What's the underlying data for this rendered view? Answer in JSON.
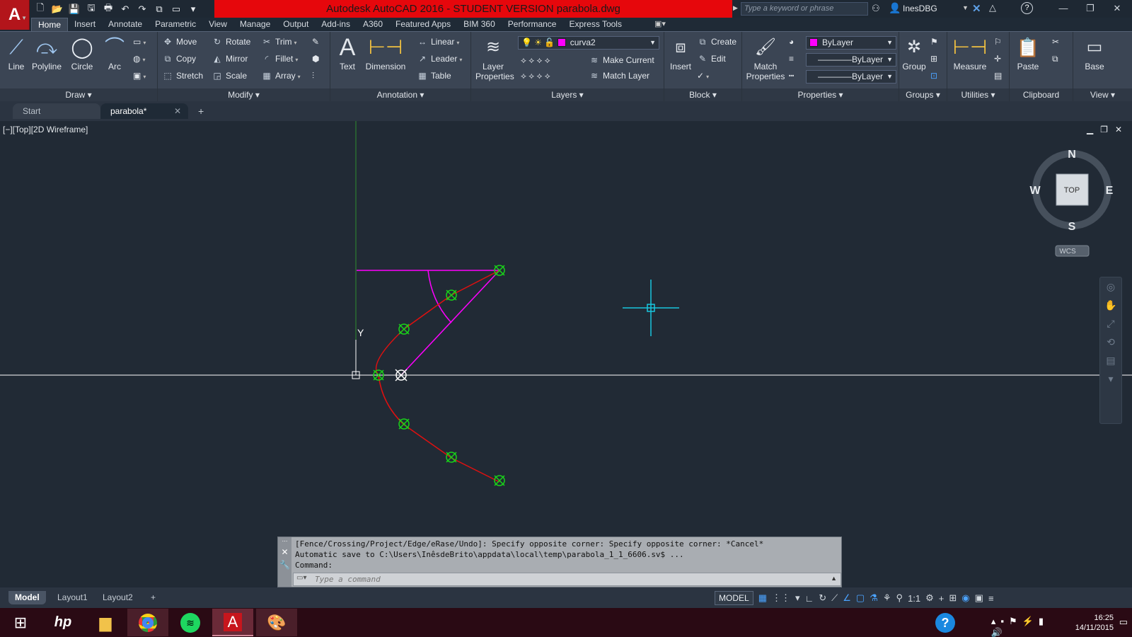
{
  "app": {
    "logo": "A",
    "title": "Autodesk AutoCAD 2016 - STUDENT VERSION    parabola.dwg",
    "search_placeholder": "Type a keyword or phrase",
    "user": "InesDBG"
  },
  "ribbon_tabs": [
    "Home",
    "Insert",
    "Annotate",
    "Parametric",
    "View",
    "Manage",
    "Output",
    "Add-ins",
    "A360",
    "Featured Apps",
    "BIM 360",
    "Performance",
    "Express Tools"
  ],
  "ribbon": {
    "draw": {
      "title": "Draw",
      "line": "Line",
      "polyline": "Polyline",
      "circle": "Circle",
      "arc": "Arc"
    },
    "modify": {
      "title": "Modify",
      "move": "Move",
      "rotate": "Rotate",
      "trim": "Trim",
      "copy": "Copy",
      "mirror": "Mirror",
      "fillet": "Fillet",
      "stretch": "Stretch",
      "scale": "Scale",
      "array": "Array"
    },
    "annotation": {
      "title": "Annotation",
      "text": "Text",
      "dimension": "Dimension",
      "linear": "Linear",
      "leader": "Leader",
      "table": "Table"
    },
    "layers": {
      "title": "Layers",
      "layer_properties": "Layer Properties",
      "current_layer": "curva2",
      "make_current": "Make Current",
      "match_layer": "Match Layer"
    },
    "block": {
      "title": "Block",
      "insert": "Insert",
      "create": "Create",
      "edit": "Edit"
    },
    "properties": {
      "title": "Properties",
      "match_properties": "Match Properties",
      "color": "ByLayer",
      "linetype": "ByLayer",
      "lineweight": "ByLayer"
    },
    "groups": {
      "title": "Groups",
      "group": "Group"
    },
    "utilities": {
      "title": "Utilities",
      "measure": "Measure"
    },
    "clipboard": {
      "title": "Clipboard",
      "paste": "Paste"
    },
    "view": {
      "title": "View",
      "base": "Base"
    }
  },
  "file_tabs": {
    "start": "Start",
    "active": "parabola*"
  },
  "viewport": {
    "label": "[−][Top][2D Wireframe]",
    "ucs_y": "Y"
  },
  "viewcube": {
    "top": "TOP",
    "n": "N",
    "s": "S",
    "e": "E",
    "w": "W",
    "wcs": "WCS"
  },
  "command": {
    "history": [
      "[Fence/Crossing/Project/Edge/eRase/Undo]: Specify opposite corner: Specify opposite corner: *Cancel*",
      "Automatic save to C:\\Users\\InêsdeBrito\\appdata\\local\\temp\\parabola_1_1_6606.sv$ ...",
      "Command:"
    ],
    "placeholder": "Type a command"
  },
  "layout_tabs": [
    "Model",
    "Layout1",
    "Layout2"
  ],
  "status": {
    "model": "MODEL",
    "scale": "1:1"
  },
  "clock": {
    "time": "16:25",
    "date": "14/11/2015"
  },
  "colors": {
    "title_red": "#e6070c",
    "magenta": "#ff00ff",
    "curve_red": "#e01010",
    "node_green": "#19d419",
    "axis_green": "#2f8f2f",
    "cursor_cyan": "#19c6de"
  }
}
